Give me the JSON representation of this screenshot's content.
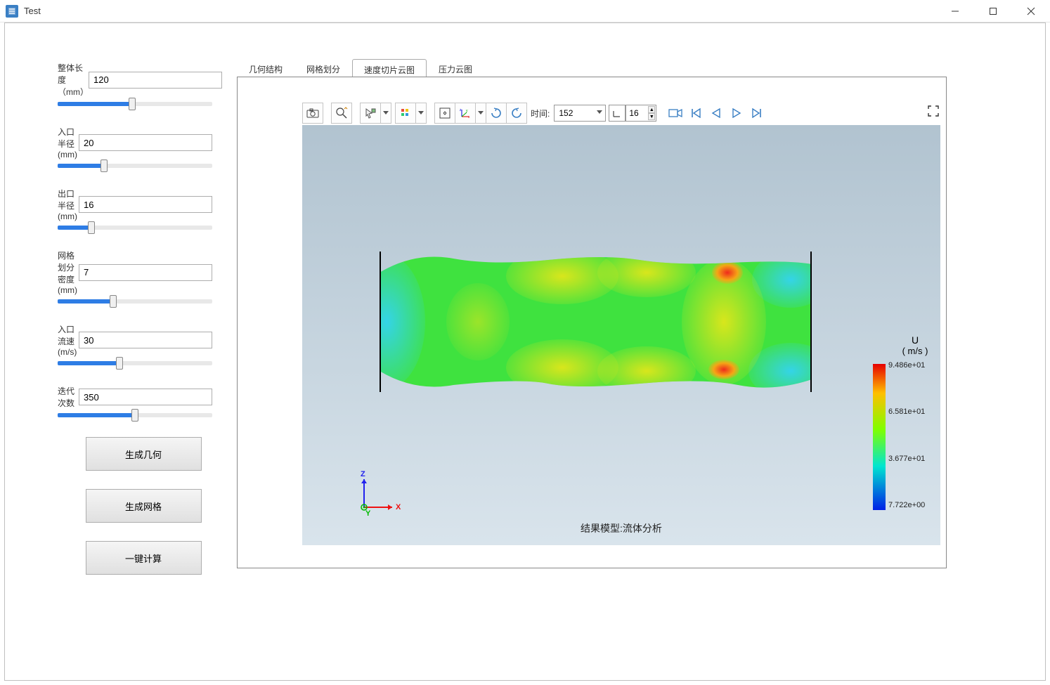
{
  "window": {
    "title": "Test"
  },
  "params": [
    {
      "label": "整体长度（mm）",
      "value": "120",
      "fill": 48
    },
    {
      "label": "入口半径(mm)",
      "value": "20",
      "fill": 30
    },
    {
      "label": "出口半径(mm)",
      "value": "16",
      "fill": 22
    },
    {
      "label": "网格划分密度(mm)",
      "value": "7",
      "fill": 36
    },
    {
      "label": "入口流速(m/s)",
      "value": "30",
      "fill": 40
    },
    {
      "label": "迭代次数",
      "value": "350",
      "fill": 50
    }
  ],
  "buttons": {
    "gen_geom": "生成几何",
    "gen_mesh": "生成网格",
    "calc": "一键计算"
  },
  "tabs": [
    {
      "label": "几何结构",
      "active": false
    },
    {
      "label": "网格划分",
      "active": false
    },
    {
      "label": "速度切片云图",
      "active": true
    },
    {
      "label": "压力云图",
      "active": false
    }
  ],
  "toolbar": {
    "time_label": "时间:",
    "time_value": "152",
    "frame_value": "16"
  },
  "legend": {
    "title": "U",
    "unit": "( m/s )",
    "ticks": [
      {
        "pos": 0,
        "label": "9.486e+01"
      },
      {
        "pos": 66,
        "label": "6.581e+01"
      },
      {
        "pos": 133,
        "label": "3.677e+01"
      },
      {
        "pos": 199,
        "label": "7.722e+00"
      }
    ]
  },
  "caption": "结果模型:流体分析",
  "axes": {
    "x": "X",
    "y": "Y",
    "z": "Z"
  }
}
